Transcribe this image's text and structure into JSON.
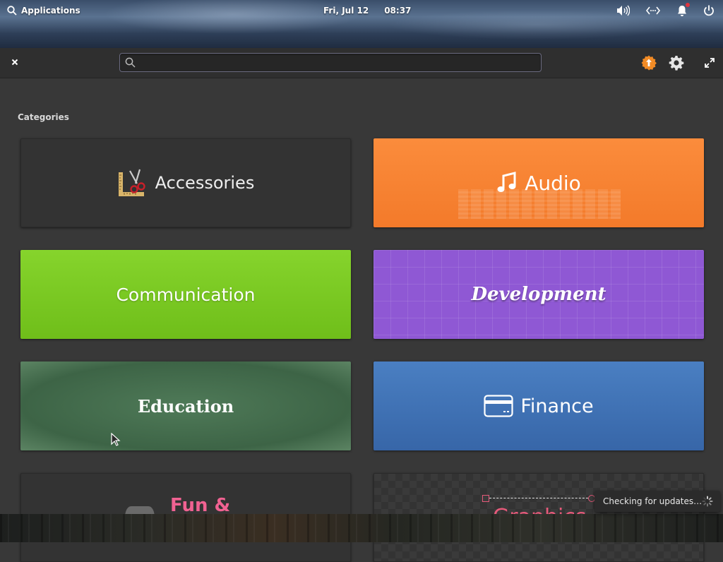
{
  "panel": {
    "applications_label": "Applications",
    "date": "Fri, Jul 12",
    "time": "08:37",
    "tray_icons": [
      "volume-icon",
      "network-icon",
      "notification-bell-icon",
      "power-icon"
    ]
  },
  "headerbar": {
    "search_placeholder": "",
    "search_value": ""
  },
  "content": {
    "section_title": "Categories",
    "categories": [
      {
        "label": "Accessories",
        "icon": "accessories-icon"
      },
      {
        "label": "Audio",
        "icon": "music-note-icon",
        "color": "#f37a2a"
      },
      {
        "label": "Communication",
        "color": "#7bc926"
      },
      {
        "label": "Development",
        "color": "#8f58d4"
      },
      {
        "label": "Education",
        "color": "#4a7252"
      },
      {
        "label": "Finance",
        "icon": "credit-card-icon",
        "color": "#3d70b2"
      },
      {
        "label": "Fun &",
        "icon": "gamepad-icon",
        "color": "#f06292"
      },
      {
        "label": "Graphics",
        "color": "#e65a7a"
      }
    ]
  },
  "toast": {
    "message": "Checking for updates…"
  }
}
